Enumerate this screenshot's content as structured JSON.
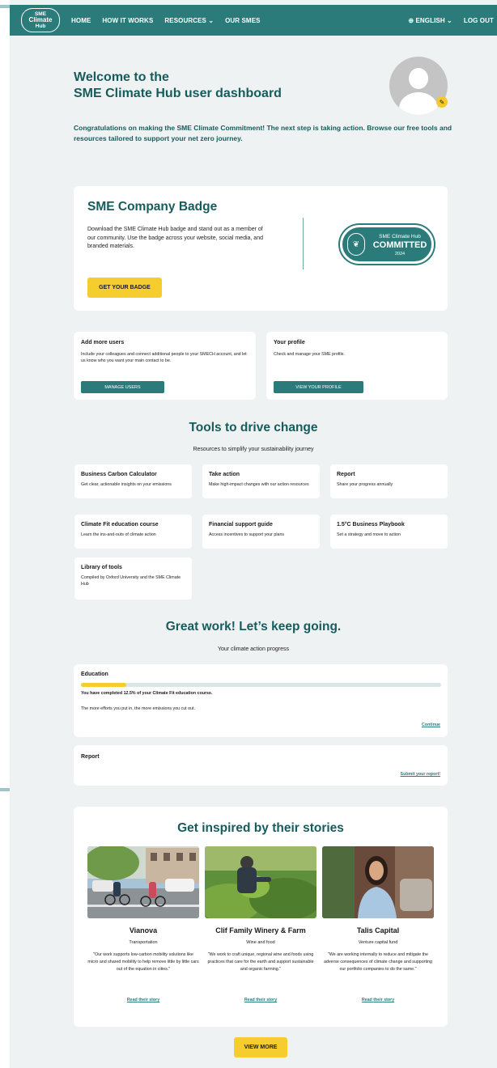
{
  "nav": {
    "logo_line1": "SME",
    "logo_line2": "Climate",
    "logo_line3": "Hub",
    "links": [
      "HOME",
      "HOW IT WORKS",
      "RESOURCES ⌄",
      "OUR SMES"
    ],
    "language": "⊕ ENGLISH ⌄",
    "logout": "LOG OUT"
  },
  "welcome": {
    "line1": "Welcome to the",
    "line2": "SME Climate Hub user dashboard",
    "congrats": "Congratulations on making the SME Climate Commitment! The next step is taking action. Browse our free tools and resources tailored to support your net zero journey."
  },
  "badge": {
    "title": "SME Company Badge",
    "text": "Download the SME Climate Hub badge and stand out as a member of our community. Use the badge across your website, social media, and branded materials.",
    "button": "GET YOUR BADGE",
    "pill_top": "SME Climate Hub",
    "pill_main": "COMMITTED",
    "pill_year": "2024"
  },
  "users_card": {
    "title": "Add more users",
    "text": "Include your colleagues and connect additional people to your SMECH account, and let us know who you want your main contact to be.",
    "button": "MANAGE USERS"
  },
  "profile_card": {
    "title": "Your profile",
    "text": "Check and manage your SME profile.",
    "button": "VIEW YOUR PROFILE"
  },
  "tools": {
    "heading": "Tools to drive change",
    "sub": "Resources to simplify your sustainability journey",
    "items": [
      {
        "title": "Business Carbon Calculator",
        "desc": "Get clear, actionable insights on your emissions"
      },
      {
        "title": "Take action",
        "desc": "Make high-impact changes with our action resources"
      },
      {
        "title": "Report",
        "desc": "Share your progress annually"
      },
      {
        "title": "Climate Fit education course",
        "desc": "Learn the ins-and-outs of climate action"
      },
      {
        "title": "Financial support guide",
        "desc": "Access incentives to support your plans"
      },
      {
        "title": "1.5°C Business Playbook",
        "desc": "Set a strategy and move to action"
      },
      {
        "title": "Library of tools",
        "desc": "Compiled by Oxford University and the SME Climate Hub"
      }
    ]
  },
  "progress": {
    "heading": "Great work! Let’s keep going.",
    "sub": "Your climate action progress",
    "education": {
      "title": "Education",
      "percent": 12.5,
      "completed": "You have completed 12.5% of your Climate Fit education course.",
      "note": "The more efforts you put in, the more emissions you cut out.",
      "link": "Continue"
    },
    "report": {
      "title": "Report",
      "link": "Submit your report!"
    }
  },
  "stories": {
    "heading": "Get inspired by their stories",
    "items": [
      {
        "name": "Vianova",
        "category": "Transportation",
        "quote": "\"Our work supports low-carbon mobility solutions like micro and shared mobility to help remove little by little cars out of the equation in cities.\"",
        "link": "Read their story"
      },
      {
        "name": "Clif Family Winery & Farm",
        "category": "Wine and food",
        "quote": "\"We work to craft unique, regional wine and foods using practices that care for the earth and support sustainable and organic farming.\"",
        "link": "Read their story"
      },
      {
        "name": "Talis Capital",
        "category": "Venture capital fund",
        "quote": "\"We are working internally to reduce and mitigate the adverse consequences of climate change and supporting our portfolio companies to do the same.\"",
        "link": "Read their story"
      }
    ],
    "view_more": "VIEW MORE"
  },
  "colors": {
    "teal": "#2c7b7b",
    "dark_teal": "#175c5c",
    "yellow": "#f6cd2f",
    "background": "#eff2f2"
  }
}
